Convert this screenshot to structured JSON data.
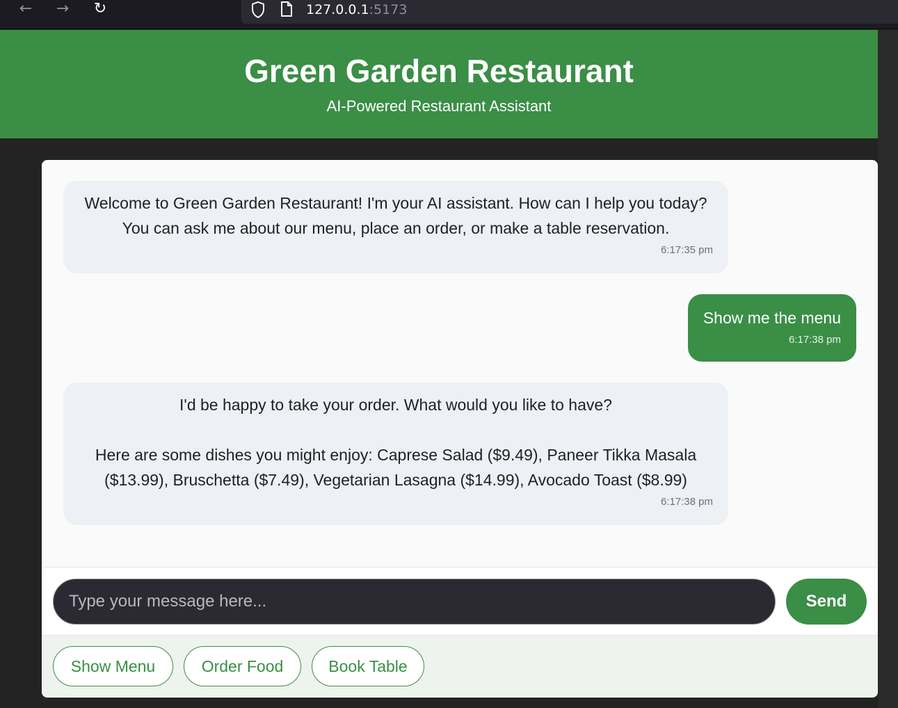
{
  "browser": {
    "url_host": "127.0.0.1",
    "url_port": ":5173",
    "icons": [
      "back-arrow-icon",
      "forward-arrow-icon",
      "reload-icon",
      "shield-icon",
      "page-icon"
    ]
  },
  "header": {
    "title": "Green Garden Restaurant",
    "subtitle": "AI-Powered Restaurant Assistant"
  },
  "messages": [
    {
      "sender": "bot",
      "text": "Welcome to Green Garden Restaurant! I'm your AI assistant. How can I help you today? You can ask me about our menu, place an order, or make a table reservation.",
      "time": "6:17:35 pm"
    },
    {
      "sender": "user",
      "text": "Show me the menu",
      "time": "6:17:38 pm"
    },
    {
      "sender": "bot",
      "text": "I'd be happy to take your order. What would you like to have?\n\nHere are some dishes you might enjoy: Caprese Salad ($9.49), Paneer Tikka Masala ($13.99), Bruschetta ($7.49), Vegetarian Lasagna ($14.99), Avocado Toast ($8.99)",
      "time": "6:17:38 pm"
    }
  ],
  "input": {
    "placeholder": "Type your message here...",
    "value": ""
  },
  "send_label": "Send",
  "quick_actions": [
    "Show Menu",
    "Order Food",
    "Book Table"
  ],
  "colors": {
    "brand_green": "#3a8e46",
    "bot_bubble": "#edf0f4",
    "page_bg": "#232323"
  }
}
